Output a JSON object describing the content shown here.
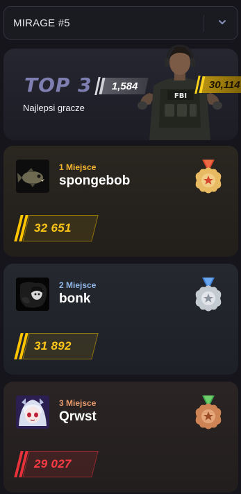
{
  "select": {
    "value": "MIRAGE #5",
    "icon": "chevron-down-icon"
  },
  "hero": {
    "title": "TOP 3",
    "subtitle": "Najlepsi gracze",
    "left_score": "1,584",
    "right_score": "30,114"
  },
  "leaderboard": [
    {
      "place_label": "1 Miejsce",
      "name": "spongebob",
      "score": "32 651",
      "place_color": "#f5b432",
      "score_style": "gold",
      "medal": "gold"
    },
    {
      "place_label": "2 Miejsce",
      "name": "bonk",
      "score": "31 892",
      "place_color": "#8fb6e6",
      "score_style": "gold",
      "medal": "silver"
    },
    {
      "place_label": "3 Miejsce",
      "name": "Qrwst",
      "score": "29 027",
      "place_color": "#e79a6a",
      "score_style": "red",
      "medal": "bronze"
    }
  ],
  "colors": {
    "accent_gold": "#ffc61a",
    "accent_red": "#ff3b45",
    "background": "#15151b"
  }
}
